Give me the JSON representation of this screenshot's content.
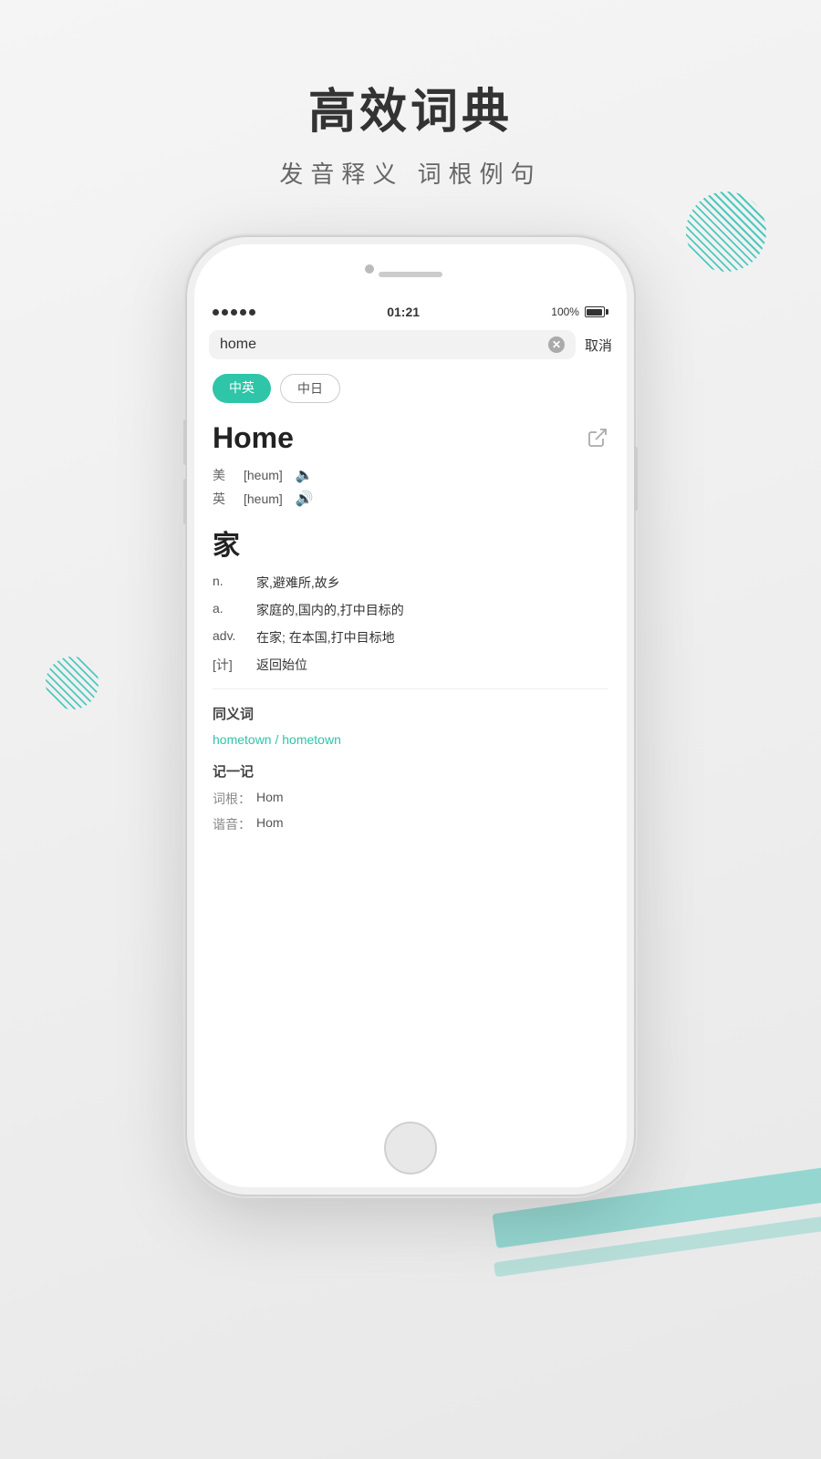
{
  "page": {
    "title": "高效词典",
    "subtitle": "发音释义  词根例句"
  },
  "status_bar": {
    "signal": "•••••",
    "time": "01:21",
    "battery": "100%"
  },
  "search": {
    "text": "home",
    "cancel_label": "取消",
    "clear_aria": "clear"
  },
  "lang_tabs": [
    {
      "label": "中英",
      "active": true
    },
    {
      "label": "中日",
      "active": false
    }
  ],
  "dictionary": {
    "word": "Home",
    "phonetics": [
      {
        "region": "美",
        "ipa": "[heum]",
        "active": false
      },
      {
        "region": "英",
        "ipa": "[heum]",
        "active": true
      }
    ],
    "cn_word": "家",
    "definitions": [
      {
        "pos": "n.",
        "text": "家,避难所,故乡"
      },
      {
        "pos": "a.",
        "text": "家庭的,国内的,打中目标的"
      },
      {
        "pos": "adv.",
        "text": "在家; 在本国,打中目标地"
      },
      {
        "pos": "[计]",
        "text": "返回始位"
      }
    ],
    "synonyms_title": "同义词",
    "synonyms": "hometown / hometown",
    "memory_title": "记一记",
    "memory": [
      {
        "label": "词根：",
        "value": "Hom"
      },
      {
        "label": "谐音：",
        "value": "Hom"
      }
    ]
  }
}
